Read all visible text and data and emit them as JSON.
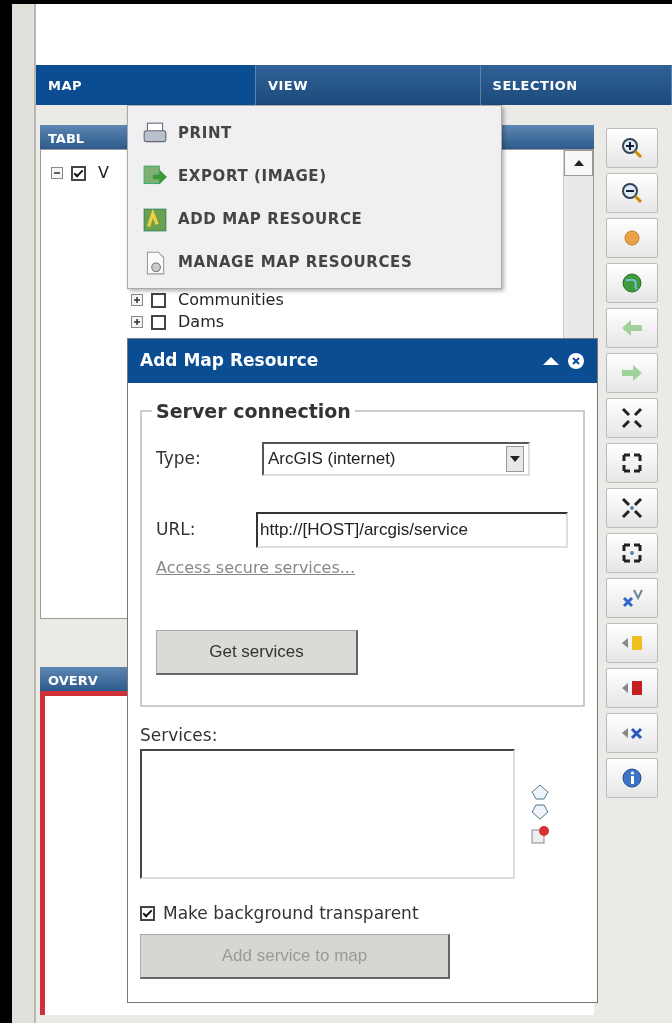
{
  "menubar": [
    {
      "label": "MAP",
      "selected": true
    },
    {
      "label": "VIEW",
      "selected": false
    },
    {
      "label": "SELECTION",
      "selected": false
    }
  ],
  "toc": {
    "title": "TABL",
    "tree": [
      {
        "label": "V",
        "checked": true,
        "expanded": true,
        "children": [
          {
            "label": "Communities",
            "checked": false,
            "expanded": false
          },
          {
            "label": "Dams",
            "checked": false,
            "expanded": false
          }
        ]
      }
    ]
  },
  "overview": {
    "title": "OVERV"
  },
  "map_menu": {
    "items": [
      {
        "label": "PRINT"
      },
      {
        "label": "EXPORT (IMAGE)"
      },
      {
        "label": "ADD MAP RESOURCE"
      },
      {
        "label": "MANAGE MAP RESOURCES"
      }
    ]
  },
  "dialog": {
    "title": "Add Map Resource",
    "server": {
      "legend": "Server connection",
      "type_label": "Type:",
      "type_value": "ArcGIS (internet)",
      "url_label": "URL:",
      "url_value": "http://[HOST]/arcgis/service",
      "link": "Access secure services...",
      "button": "Get services"
    },
    "services_label": "Services:",
    "transparent": {
      "label": "Make background transparent",
      "checked": true
    },
    "add_button": {
      "label": "Add service to map",
      "disabled": true
    }
  }
}
